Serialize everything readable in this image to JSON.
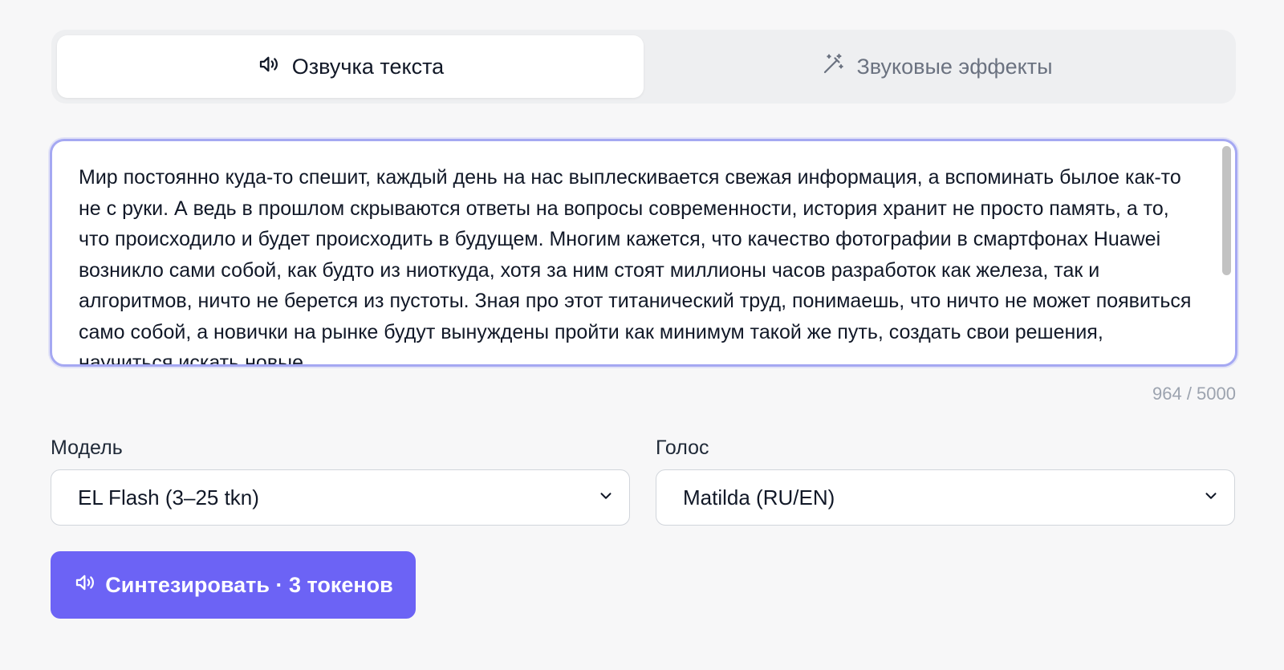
{
  "tabs": [
    {
      "label": "Озвучка текста",
      "icon": "speaker-icon",
      "active": true
    },
    {
      "label": "Звуковые эффекты",
      "icon": "magic-wand-icon",
      "active": false
    }
  ],
  "editor": {
    "text": "Мир постоянно куда-то спешит, каждый день на нас выплескивается свежая информация, а вспоминать былое как-то не с руки. А ведь в прошлом скрываются ответы на вопросы современности, история хранит не просто память, а то, что происходило и будет происходить в будущем. Многим кажется, что качество фотографии в смартфонах Huawei возникло сами собой, как будто из ниоткуда, хотя за ним стоят миллионы часов разработок как железа, так и алгоритмов, ничто не берется из пустоты. Зная про этот титанический труд, понимаешь, что ничто не может появиться само собой, а новички на рынке будут вынуждены пройти как минимум такой же путь, создать свои решения, научиться искать новые",
    "counter": "964 / 5000"
  },
  "model": {
    "label": "Модель",
    "selected": "EL Flash (3–25 tkn)"
  },
  "voice": {
    "label": "Голос",
    "selected": "Matilda (RU/EN)"
  },
  "synthesize_button": {
    "label": "Синтезировать · 3 токенов",
    "icon": "speaker-icon"
  },
  "colors": {
    "accent": "#6c63f5",
    "focus_border": "#a5a8f2",
    "background": "#f7f7f8"
  }
}
